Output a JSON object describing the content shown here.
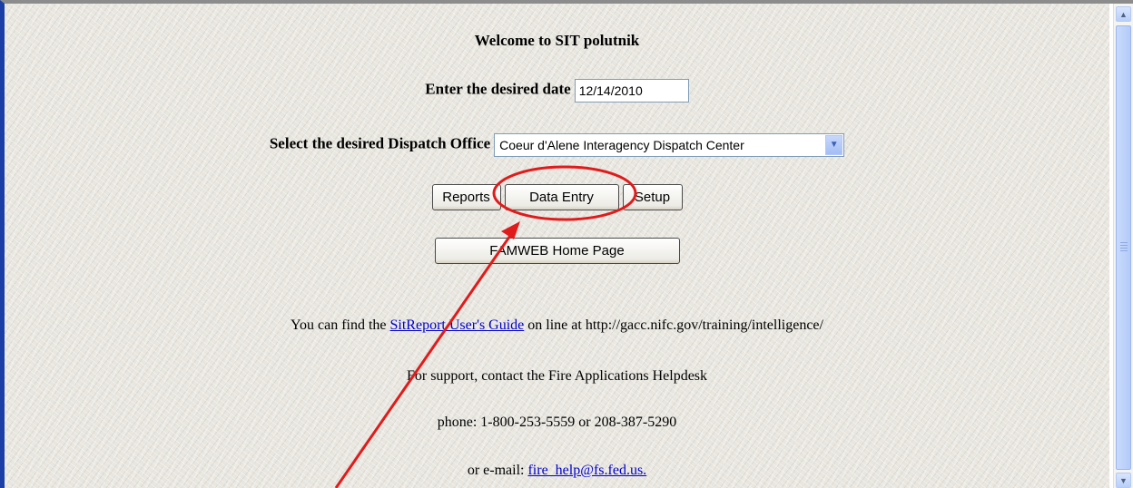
{
  "welcome": "Welcome to SIT polutnik",
  "date": {
    "label": "Enter the desired date",
    "value": "12/14/2010"
  },
  "office": {
    "label": "Select the desired Dispatch Office",
    "selected": "Coeur d'Alene Interagency Dispatch Center"
  },
  "buttons": {
    "reports": "Reports",
    "data_entry": "Data Entry",
    "setup": "Setup",
    "famweb": "FAMWEB Home Page"
  },
  "guide": {
    "prefix": "You can find the",
    "link": "SitReport User's Guide",
    "suffix": "on line at http://gacc.nifc.gov/training/intelligence/"
  },
  "support": "For support, contact the Fire Applications Helpdesk",
  "phone": "phone: 1-800-253-5559 or 208-387-5290",
  "email": {
    "prefix": "or e-mail:",
    "link": "fire_help@fs.fed.us."
  },
  "annotation_color": "#e01b1b",
  "scrollbar": {
    "up_icon": "arrow-up",
    "down_icon": "arrow-down"
  }
}
